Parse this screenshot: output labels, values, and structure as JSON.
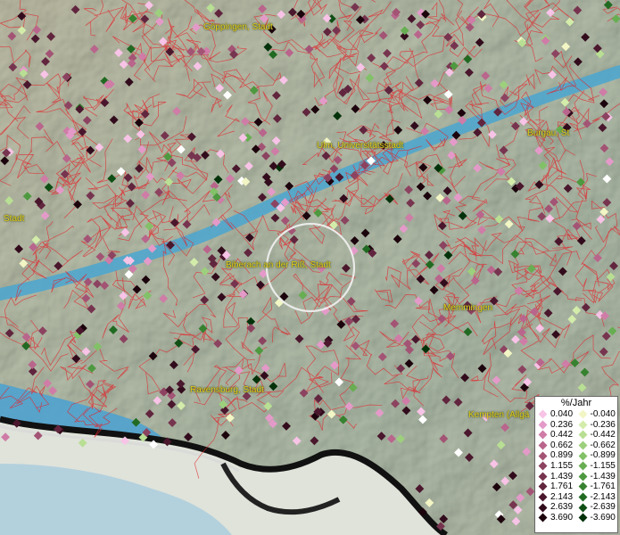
{
  "cities": [
    {
      "id": "goeppingen",
      "label": "Göppingen, Stadt"
    },
    {
      "id": "ulm",
      "label": "Ulm, Universitätsstadt"
    },
    {
      "id": "burgau",
      "label": "Burgau, St"
    },
    {
      "id": "biberach",
      "label": "Biberach an der Riß, Stadt"
    },
    {
      "id": "memmingen",
      "label": "Memmingen"
    },
    {
      "id": "ravensburg",
      "label": "Ravensburg, Stadt"
    },
    {
      "id": "kempten",
      "label": "Kempten (Allgä"
    },
    {
      "id": "left_stadt",
      "label": "Stadt"
    }
  ],
  "legend": {
    "title": "%/Jahr",
    "positive": [
      {
        "value": "0.040",
        "color": "#f7c3e6"
      },
      {
        "value": "0.236",
        "color": "#e49ac9"
      },
      {
        "value": "0.442",
        "color": "#cf7ca7"
      },
      {
        "value": "0.662",
        "color": "#b9658c"
      },
      {
        "value": "0.899",
        "color": "#a35474"
      },
      {
        "value": "1.155",
        "color": "#8c4360"
      },
      {
        "value": "1.439",
        "color": "#77344f"
      },
      {
        "value": "1.761",
        "color": "#61253e"
      },
      {
        "value": "2.143",
        "color": "#4a172d"
      },
      {
        "value": "2.639",
        "color": "#320c1c"
      },
      {
        "value": "3.690",
        "color": "#1c040d"
      }
    ],
    "negative": [
      {
        "value": "-0.040",
        "color": "#f2f5c4"
      },
      {
        "value": "-0.236",
        "color": "#d3ecaa"
      },
      {
        "value": "-0.442",
        "color": "#b8df93"
      },
      {
        "value": "-0.662",
        "color": "#9dd07c"
      },
      {
        "value": "-0.899",
        "color": "#82c167"
      },
      {
        "value": "-1.155",
        "color": "#67ae52"
      },
      {
        "value": "-1.439",
        "color": "#4e9940"
      },
      {
        "value": "-1.761",
        "color": "#378230"
      },
      {
        "value": "-2.143",
        "color": "#216a22"
      },
      {
        "value": "-2.639",
        "color": "#0f4f15"
      },
      {
        "value": "-3.690",
        "color": "#03320a"
      }
    ]
  }
}
